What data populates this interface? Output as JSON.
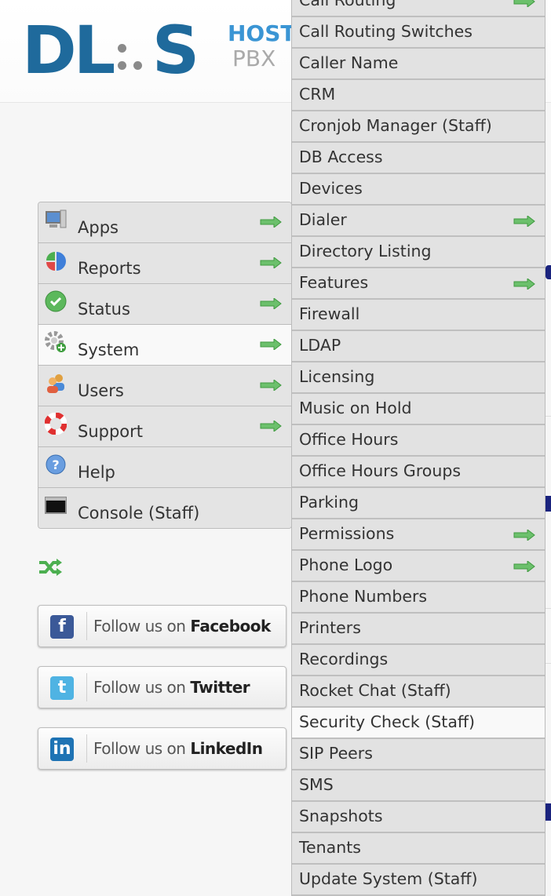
{
  "logo": {
    "main": "DL S",
    "line1": "HOSTED",
    "line2": "PBX"
  },
  "colors": {
    "logo_blue": "#1f6a9c",
    "arrow_green": "#5cb85c",
    "menu_bg": "#e4e4e4",
    "active_bg": "#f9f9f9"
  },
  "main_menu": [
    {
      "label": "Apps",
      "icon": "computer-icon",
      "has_submenu": true
    },
    {
      "label": "Reports",
      "icon": "pie-chart-icon",
      "has_submenu": true
    },
    {
      "label": "Status",
      "icon": "check-circle-icon",
      "has_submenu": true
    },
    {
      "label": "System",
      "icon": "gear-icon",
      "has_submenu": true,
      "active": true
    },
    {
      "label": "Users",
      "icon": "users-icon",
      "has_submenu": true
    },
    {
      "label": "Support",
      "icon": "lifebuoy-icon",
      "has_submenu": true
    },
    {
      "label": "Help",
      "icon": "help-icon",
      "has_submenu": false
    },
    {
      "label": "Console (Staff)",
      "icon": "terminal-icon",
      "has_submenu": false
    }
  ],
  "system_submenu": [
    {
      "label": "Call Routing",
      "has_submenu": true
    },
    {
      "label": "Call Routing Switches",
      "has_submenu": false
    },
    {
      "label": "Caller Name",
      "has_submenu": false
    },
    {
      "label": "CRM",
      "has_submenu": false
    },
    {
      "label": "Cronjob Manager (Staff)",
      "has_submenu": false
    },
    {
      "label": "DB Access",
      "has_submenu": false
    },
    {
      "label": "Devices",
      "has_submenu": false
    },
    {
      "label": "Dialer",
      "has_submenu": true
    },
    {
      "label": "Directory Listing",
      "has_submenu": false
    },
    {
      "label": "Features",
      "has_submenu": true
    },
    {
      "label": "Firewall",
      "has_submenu": false
    },
    {
      "label": "LDAP",
      "has_submenu": false
    },
    {
      "label": "Licensing",
      "has_submenu": false
    },
    {
      "label": "Music on Hold",
      "has_submenu": false
    },
    {
      "label": "Office Hours",
      "has_submenu": false
    },
    {
      "label": "Office Hours Groups",
      "has_submenu": false
    },
    {
      "label": "Parking",
      "has_submenu": false
    },
    {
      "label": "Permissions",
      "has_submenu": true
    },
    {
      "label": "Phone Logo",
      "has_submenu": true
    },
    {
      "label": "Phone Numbers",
      "has_submenu": false
    },
    {
      "label": "Printers",
      "has_submenu": false
    },
    {
      "label": "Recordings",
      "has_submenu": false
    },
    {
      "label": "Rocket Chat (Staff)",
      "has_submenu": false
    },
    {
      "label": "Security Check (Staff)",
      "has_submenu": false,
      "active": true
    },
    {
      "label": "SIP Peers",
      "has_submenu": false
    },
    {
      "label": "SMS",
      "has_submenu": false
    },
    {
      "label": "Snapshots",
      "has_submenu": false
    },
    {
      "label": "Tenants",
      "has_submenu": false
    },
    {
      "label": "Update System (Staff)",
      "has_submenu": false
    }
  ],
  "social": [
    {
      "prefix": "Follow us on ",
      "network": "Facebook",
      "glyph": "f",
      "color": "#3b5998"
    },
    {
      "prefix": "Follow us on ",
      "network": "Twitter",
      "glyph": "t",
      "color": "#4fb3e3"
    },
    {
      "prefix": "Follow us on ",
      "network": "LinkedIn",
      "glyph": "in",
      "color": "#1e73b4"
    }
  ]
}
